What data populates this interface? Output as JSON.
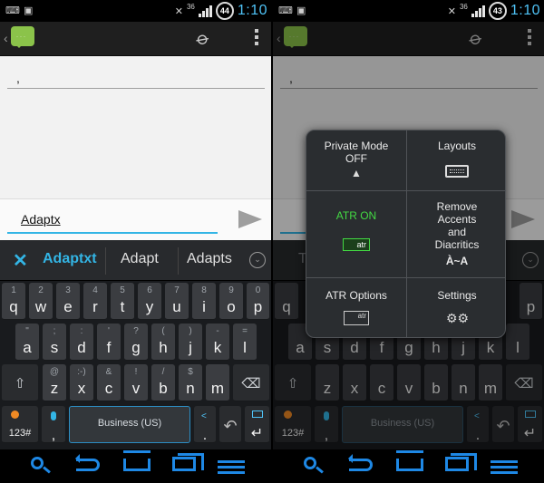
{
  "status": {
    "signal": "36",
    "battery": "44",
    "battery_right": "43",
    "time": "1:10"
  },
  "left": {
    "compose": {
      "to_text": ",",
      "message_text": "Adaptx"
    },
    "suggestions": [
      "Adaptxt",
      "Adapt",
      "Adapts"
    ],
    "dismiss_symbol": "✕",
    "more_symbol": "⌄"
  },
  "right": {
    "compose": {
      "to_text": ","
    },
    "suggestions": [
      "The",
      "To",
      "I"
    ],
    "popup": {
      "private_mode_label": "Private Mode",
      "private_mode_state": "OFF",
      "layouts_label": "Layouts",
      "atr_label": "ATR ON",
      "atr_icon_text": "atr",
      "remove_accents_line1": "Remove",
      "remove_accents_line2": "Accents",
      "remove_accents_line3": "and",
      "remove_accents_line4": "Diacritics",
      "accent_sample": "À~A",
      "atr_options_label": "ATR Options",
      "atr_options_icon_text": "atr",
      "settings_label": "Settings"
    }
  },
  "keyboard": {
    "row1": [
      {
        "alt": "1",
        "main": "q"
      },
      {
        "alt": "2",
        "main": "w"
      },
      {
        "alt": "3",
        "main": "e"
      },
      {
        "alt": "4",
        "main": "r"
      },
      {
        "alt": "5",
        "main": "t"
      },
      {
        "alt": "6",
        "main": "y"
      },
      {
        "alt": "7",
        "main": "u"
      },
      {
        "alt": "8",
        "main": "i"
      },
      {
        "alt": "9",
        "main": "o"
      },
      {
        "alt": "0",
        "main": "p"
      }
    ],
    "row2": [
      {
        "alt": "\"",
        "main": "a"
      },
      {
        "alt": ";",
        "main": "s"
      },
      {
        "alt": ":",
        "main": "d"
      },
      {
        "alt": "'",
        "main": "f"
      },
      {
        "alt": "?",
        "main": "g"
      },
      {
        "alt": "(",
        "main": "h"
      },
      {
        "alt": ")",
        "main": "j"
      },
      {
        "alt": "-",
        "main": "k"
      },
      {
        "alt": "=",
        "main": "l"
      }
    ],
    "row3": [
      {
        "alt": "@",
        "main": "z"
      },
      {
        "alt": ":-)",
        "main": "x"
      },
      {
        "alt": "&",
        "main": "c"
      },
      {
        "alt": "!",
        "main": "v"
      },
      {
        "alt": "/",
        "main": "b"
      },
      {
        "alt": "$",
        "main": "n"
      },
      {
        "alt": "",
        "main": "m"
      }
    ],
    "row2_extra_alt": "/",
    "shift_symbol": "⇧",
    "delete_symbol": "⌫",
    "mode_key_label": "123#",
    "comma_label": ",",
    "space_label": "Business (US)",
    "period_label": ".",
    "undo_symbol": "↶",
    "enter_symbol": "↵"
  },
  "right_keyboard": {
    "row1": [
      "q",
      "w",
      "e",
      "r",
      "t",
      "y",
      "u",
      "i",
      "o",
      "p"
    ],
    "row2": [
      "a",
      "s",
      "d",
      "f",
      "g",
      "h",
      "j",
      "k",
      "l"
    ],
    "row3": [
      "z",
      "x",
      "c",
      "v",
      "b",
      "n",
      "m"
    ]
  },
  "colors": {
    "accent": "#33b5e5",
    "nav_blue": "#1e88e5",
    "atr_green": "#43d943",
    "messaging_green": "#8bc34a"
  }
}
